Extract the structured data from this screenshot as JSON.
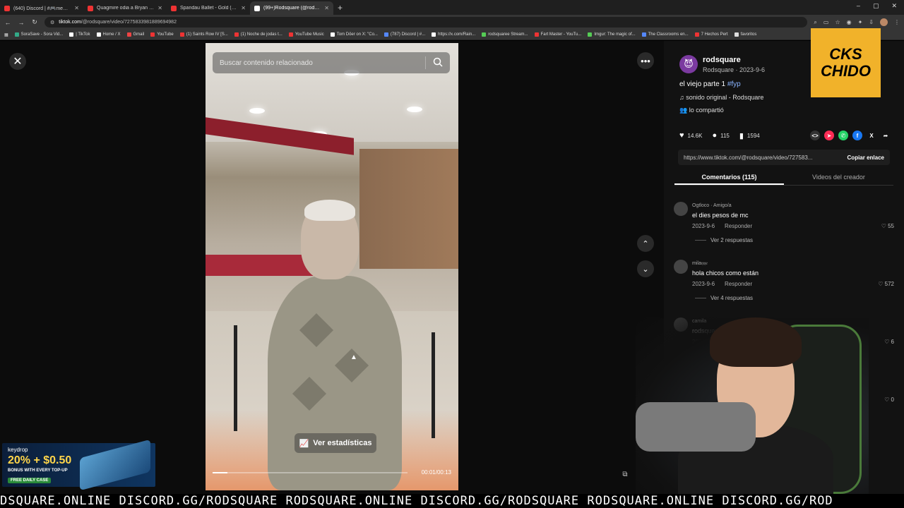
{
  "browser": {
    "tabs": [
      {
        "title": "(640) Discord | #🎮memes🎮",
        "color": "#e33"
      },
      {
        "title": "Quagmire odia a Bryan (Padre",
        "color": "#e33"
      },
      {
        "title": "Spandau Ballet - Gold (HD Rem",
        "color": "#e33"
      },
      {
        "title": "(99+)Rodsquare (@rodsqu",
        "color": "#fff",
        "active": true
      }
    ],
    "url_host": "tiktok.com",
    "url_path": "/@rodsquare/video/7275833981889694982",
    "bookmarks": [
      {
        "label": "SoraSave - Sora Vid...",
        "color": "#3a8"
      },
      {
        "label": "| TikTok",
        "color": "#fff"
      },
      {
        "label": "Home / X",
        "color": "#fff"
      },
      {
        "label": "Gmail",
        "color": "#e44"
      },
      {
        "label": "YouTube",
        "color": "#e33"
      },
      {
        "label": "(1) Saints Row IV [S...",
        "color": "#e33"
      },
      {
        "label": "(1) Noche de jodas t...",
        "color": "#e33"
      },
      {
        "label": "YouTube Music",
        "color": "#e33"
      },
      {
        "label": "Tom Döer on X: \"Co...",
        "color": "#fff"
      },
      {
        "label": "(787) Discord | #...",
        "color": "#58f"
      },
      {
        "label": "https://x.com/Rain...",
        "color": "#fff"
      },
      {
        "label": "rodsquaree Stream...",
        "color": "#5c5"
      },
      {
        "label": "Fart Master - YouTu...",
        "color": "#e33"
      },
      {
        "label": "Imgur: The magic of...",
        "color": "#5c5"
      },
      {
        "label": "The Classrooms en...",
        "color": "#58f"
      },
      {
        "label": "7 Hechos Pert",
        "color": "#e33"
      },
      {
        "label": "favoritos",
        "color": "#ddd"
      }
    ]
  },
  "video": {
    "search_placeholder": "Buscar contenido relacionado",
    "stats_label": "Ver estadísticas",
    "timecode": "00:01/00:13",
    "progress_fraction": 0.077
  },
  "post": {
    "author": "rodsquare",
    "author_sub": "Rodsquare · 2023-9-6",
    "caption": "el viejo parte 1",
    "hashtag": "#fyp",
    "music": "sonido original - Rodsquare",
    "shared": "lo compartió",
    "likes": "14.6K",
    "comments_count": "115",
    "saves": "1594",
    "link": "https://www.tiktok.com/@rodsquare/video/727583...",
    "copy_label": "Copiar enlace",
    "tab_comments": "Comentarios (115)",
    "tab_creator": "Videos del creador"
  },
  "comments": [
    {
      "user": "Ogtloco · Amigo/a",
      "text": "el dies pesos de mc",
      "date": "2023-9-6",
      "reply": "Responder",
      "likes": "55",
      "replies": "Ver 2 respuestas"
    },
    {
      "user": "mila𝔶𝔶𝔢",
      "text": "hola chicos como están",
      "date": "2023-9-6",
      "reply": "Responder",
      "likes": "572",
      "replies": "Ver 4 respuestas"
    },
    {
      "user": "camila",
      "text": "rodsquare d",
      "date": "2023-9-8",
      "reply": "",
      "likes": "6",
      "replies": ""
    },
    {
      "user": "rott.martyJ",
      "text": "My Hola ch",
      "date": "2023-9-13",
      "reply": "",
      "likes": "0",
      "replies": ""
    }
  ],
  "overlay": {
    "chido_top": "CKS",
    "chido_bottom": "CHIDO",
    "keydrop_brand": "keydrop",
    "keydrop_offer": "20% + $0.50",
    "keydrop_sub": "BONUS WITH EVERY TOP-UP",
    "keydrop_case": "FREE DAILY CASE",
    "ticker": "DSQUARE.ONLINE DISCORD.GG/RODSQUARE RODSQUARE.ONLINE DISCORD.GG/RODSQUARE RODSQUARE.ONLINE DISCORD.GG/ROD"
  }
}
